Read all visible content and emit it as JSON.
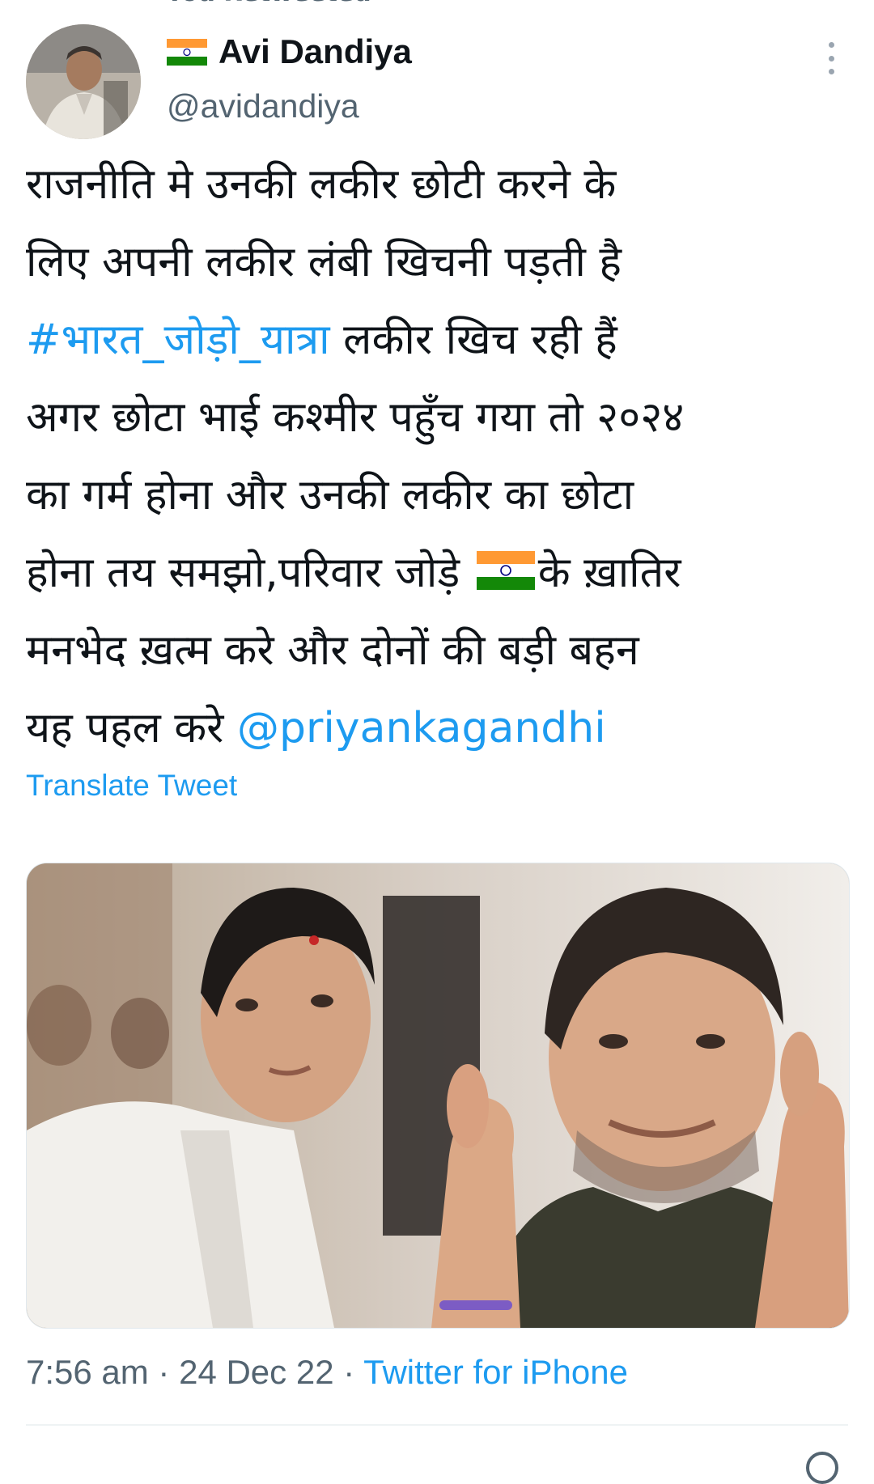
{
  "retweet": {
    "label": "You Retweeted"
  },
  "author": {
    "display_name": "Avi Dandiya",
    "handle": "@avidandiya",
    "avatar_icon": "avatar-photo",
    "flag_icon": "india-flag-icon"
  },
  "tweet": {
    "lines": [
      {
        "parts": [
          {
            "text": "राजनीति मे उनकी लकीर छोटी करने के",
            "type": "text"
          }
        ]
      },
      {
        "parts": [
          {
            "text": "लिए अपनी लकीर लंबी खिचनी पड़ती है",
            "type": "text"
          }
        ]
      },
      {
        "parts": [
          {
            "text": "#भारत_जोड़ो_यात्रा",
            "type": "hashtag"
          },
          {
            "text": " लकीर खिच रही हैं",
            "type": "text"
          }
        ]
      },
      {
        "parts": [
          {
            "text": "अगर छोटा भाई कश्मीर पहुँच गया तो २०२४",
            "type": "text"
          }
        ]
      },
      {
        "parts": [
          {
            "text": "का गर्म होना और उनकी लकीर का छोटा",
            "type": "text"
          }
        ]
      },
      {
        "parts": [
          {
            "text": "होना तय समझो,परिवार जोड़े ",
            "type": "text"
          },
          {
            "text": "",
            "type": "flag"
          },
          {
            "text": "के ख़ातिर",
            "type": "text"
          }
        ]
      },
      {
        "parts": [
          {
            "text": "मनभेद ख़त्म करे और दोनों की बड़ी बहन",
            "type": "text"
          }
        ]
      },
      {
        "parts": [
          {
            "text": "यह पहल करे ",
            "type": "text"
          },
          {
            "text": "@priyankagandhi",
            "type": "mention"
          }
        ]
      }
    ],
    "translate_label": "Translate Tweet"
  },
  "media": {
    "description_icon": "photo-two-men-thumbs-up"
  },
  "meta": {
    "time": "7:56 am",
    "separator": " · ",
    "date": "24 Dec 22",
    "source": "Twitter for iPhone"
  },
  "colors": {
    "link": "#1d9bf0",
    "secondary_text": "#536471",
    "primary_text": "#0f1419",
    "background": "#ffffff"
  }
}
